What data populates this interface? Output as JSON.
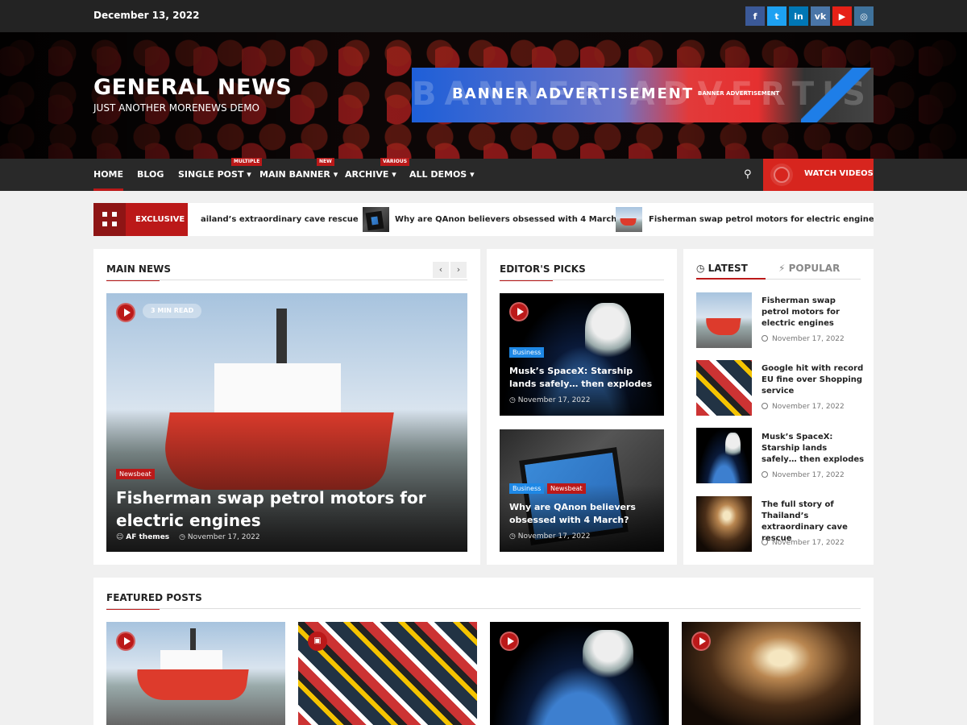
{
  "topbar": {
    "date": "December 13, 2022",
    "social": [
      {
        "icon": "facebook-icon",
        "glyph": "f",
        "color": "#3b5998"
      },
      {
        "icon": "twitter-icon",
        "glyph": "t",
        "color": "#1da1f2"
      },
      {
        "icon": "linkedin-icon",
        "glyph": "in",
        "color": "#0077b5"
      },
      {
        "icon": "vk-icon",
        "glyph": "vk",
        "color": "#4a76a8"
      },
      {
        "icon": "youtube-icon",
        "glyph": "▶",
        "color": "#e62117"
      },
      {
        "icon": "instagram-icon",
        "glyph": "◎",
        "color": "#3f729b"
      }
    ]
  },
  "header": {
    "title": "GENERAL NEWS",
    "tagline": "JUST ANOTHER MORENEWS DEMO",
    "banner_main": "BANNER ADVERTISEMENT",
    "banner_small": "BANNER ADVERTISEMENT",
    "banner_ghost": "BANNER ADVERTISEME"
  },
  "nav": {
    "items": [
      "HOME",
      "BLOG",
      "SINGLE POST",
      "MAIN BANNER",
      "ARCHIVE",
      "ALL DEMOS"
    ],
    "tags": [
      "MULTIPLE",
      "NEW",
      "VARIOUS"
    ],
    "watch_label": "WATCH VIDEOS"
  },
  "ticker": {
    "label": "EXCLUSIVE",
    "items": [
      "ailand’s extraordinary cave rescue",
      "Why are QAnon believers obsessed with 4 March?",
      "Fisherman swap petrol motors for electric engines"
    ]
  },
  "main_news": {
    "title": "MAIN NEWS",
    "read_time": "3 MIN READ",
    "category": "Newsbeat",
    "headline": "Fisherman swap petrol motors for electric engines",
    "author": "AF themes",
    "date": "November 17, 2022"
  },
  "editors_picks": {
    "title": "EDITOR'S PICKS",
    "items": [
      {
        "categories": [
          "Business"
        ],
        "headline": "Musk’s SpaceX: Starship lands safely… then explodes",
        "date": "November 17, 2022"
      },
      {
        "categories": [
          "Business",
          "Newsbeat"
        ],
        "headline": "Why are QAnon believers obsessed with 4 March?",
        "date": "November 17, 2022"
      }
    ]
  },
  "sidebar": {
    "tab_latest": "LATEST",
    "tab_popular": "POPULAR",
    "items": [
      {
        "title": "Fisherman swap petrol motors for electric engines",
        "date": "November 17, 2022"
      },
      {
        "title": "Google hit with record EU fine over Shopping service",
        "date": "November 17, 2022"
      },
      {
        "title": "Musk’s SpaceX: Starship lands safely… then explodes",
        "date": "November 17, 2022"
      },
      {
        "title": "The full story of Thailand’s extraordinary cave rescue",
        "date": "November 17, 2022"
      }
    ]
  },
  "featured": {
    "title": "FEATURED POSTS"
  }
}
